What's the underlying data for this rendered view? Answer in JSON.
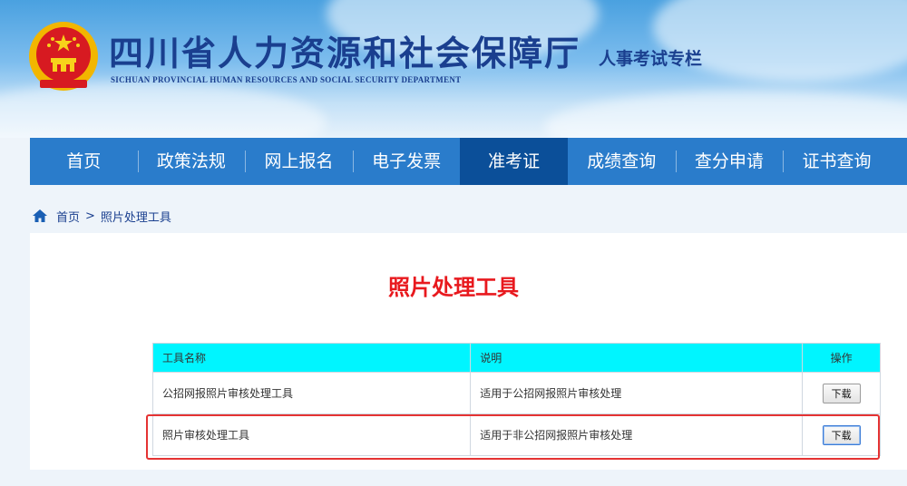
{
  "header": {
    "title_cn": "四川省人力资源和社会保障厅",
    "title_en": "SICHUAN PROVINCIAL HUMAN RESOURCES AND SOCIAL SECURITY DEPARTMENT",
    "subtitle": "人事考试专栏"
  },
  "nav": {
    "items": [
      {
        "label": "首页"
      },
      {
        "label": "政策法规"
      },
      {
        "label": "网上报名"
      },
      {
        "label": "电子发票"
      },
      {
        "label": "准考证"
      },
      {
        "label": "成绩查询"
      },
      {
        "label": "查分申请"
      },
      {
        "label": "证书查询"
      }
    ],
    "active_index": 4
  },
  "breadcrumb": {
    "home": "首页",
    "separator": ">",
    "current": "照片处理工具"
  },
  "page": {
    "title": "照片处理工具"
  },
  "table": {
    "headers": {
      "name": "工具名称",
      "desc": "说明",
      "op": "操作"
    },
    "rows": [
      {
        "name": "公招网报照片审核处理工具",
        "desc": "适用于公招网报照片审核处理",
        "button": "下载"
      },
      {
        "name": "照片审核处理工具",
        "desc": "适用于非公招网报照片审核处理",
        "button": "下载"
      }
    ]
  },
  "colors": {
    "nav_bg": "#2a7ccb",
    "nav_active": "#0b4f99",
    "title_red": "#e8191e",
    "table_header": "#00f5ff",
    "highlight_border": "#e53333"
  }
}
